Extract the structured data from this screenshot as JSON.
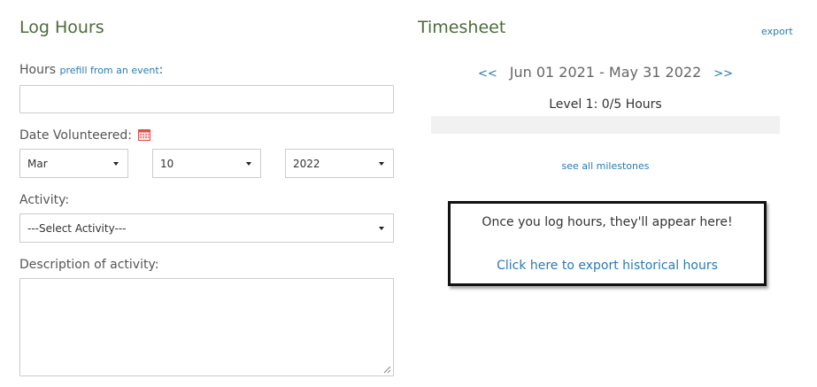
{
  "log_hours": {
    "title": "Log Hours",
    "hours_label": "Hours",
    "prefill_link": "prefill from an event",
    "hours_suffix": ":",
    "hours_value": "",
    "date_label": "Date Volunteered:",
    "month": "Mar",
    "day": "10",
    "year": "2022",
    "activity_label": "Activity:",
    "activity_selected": "---Select Activity---",
    "description_label": "Description of activity:",
    "description_value": ""
  },
  "timesheet": {
    "title": "Timesheet",
    "export_link": "export",
    "prev": "<<",
    "date_range": "Jun 01 2021 - May 31 2022",
    "next": ">>",
    "level_text": "Level 1: 0/5 Hours",
    "level_progress": 0,
    "milestones_link": "see all milestones",
    "empty_message": "Once you log hours, they'll appear here!",
    "export_historical_link": "Click here to export historical hours"
  },
  "colors": {
    "heading": "#4d6b3a",
    "link": "#2a7bb0",
    "progress_track": "#f1f1f1"
  }
}
